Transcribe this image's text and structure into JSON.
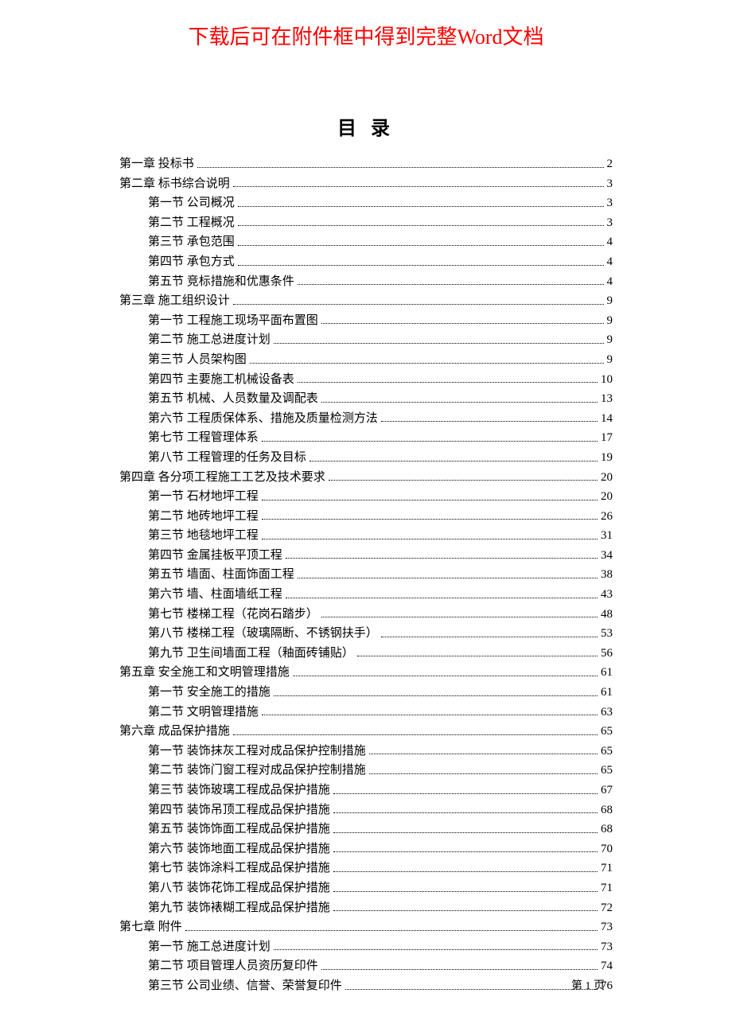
{
  "banner": "下载后可在附件框中得到完整Word文档",
  "title": "目  录",
  "toc": [
    {
      "level": 1,
      "label": "第一章  投标书",
      "page": "2"
    },
    {
      "level": 1,
      "label": "第二章  标书综合说明",
      "page": "3"
    },
    {
      "level": 2,
      "label": "第一节  公司概况",
      "page": "3"
    },
    {
      "level": 2,
      "label": "第二节  工程概况",
      "page": "3"
    },
    {
      "level": 2,
      "label": "第三节  承包范围",
      "page": "4"
    },
    {
      "level": 2,
      "label": "第四节  承包方式",
      "page": "4"
    },
    {
      "level": 2,
      "label": "第五节  竞标措施和优惠条件",
      "page": "4"
    },
    {
      "level": 1,
      "label": "第三章  施工组织设计",
      "page": "9"
    },
    {
      "level": 2,
      "label": "第一节  工程施工现场平面布置图",
      "page": "9"
    },
    {
      "level": 2,
      "label": "第二节  施工总进度计划",
      "page": "9"
    },
    {
      "level": 2,
      "label": "第三节  人员架构图",
      "page": "9"
    },
    {
      "level": 2,
      "label": "第四节  主要施工机械设备表",
      "page": "10"
    },
    {
      "level": 2,
      "label": "第五节  机械、人员数量及调配表",
      "page": "13"
    },
    {
      "level": 2,
      "label": "第六节  工程质保体系、措施及质量检测方法",
      "page": "14"
    },
    {
      "level": 2,
      "label": "第七节  工程管理体系",
      "page": "17"
    },
    {
      "level": 2,
      "label": "第八节  工程管理的任务及目标",
      "page": "19"
    },
    {
      "level": 1,
      "label": "第四章  各分项工程施工工艺及技术要求",
      "page": "20"
    },
    {
      "level": 2,
      "label": "第一节  石材地坪工程",
      "page": "20"
    },
    {
      "level": 2,
      "label": "第二节  地砖地坪工程",
      "page": "26"
    },
    {
      "level": 2,
      "label": "第三节  地毯地坪工程",
      "page": "31"
    },
    {
      "level": 2,
      "label": "第四节  金属挂板平顶工程",
      "page": "34"
    },
    {
      "level": 2,
      "label": "第五节  墙面、柱面饰面工程",
      "page": "38"
    },
    {
      "level": 2,
      "label": "第六节  墙、柱面墙纸工程",
      "page": "43"
    },
    {
      "level": 2,
      "label": "第七节  楼梯工程（花岗石踏步）",
      "page": "48"
    },
    {
      "level": 2,
      "label": "第八节  楼梯工程（玻璃隔断、不锈钢扶手）",
      "page": "53"
    },
    {
      "level": 2,
      "label": "第九节  卫生间墙面工程（釉面砖铺贴）",
      "page": "56"
    },
    {
      "level": 1,
      "label": "第五章  安全施工和文明管理措施",
      "page": "61"
    },
    {
      "level": 2,
      "label": "第一节  安全施工的措施",
      "page": "61"
    },
    {
      "level": 2,
      "label": "第二节  文明管理措施",
      "page": "63"
    },
    {
      "level": 1,
      "label": "第六章  成品保护措施",
      "page": "65"
    },
    {
      "level": 2,
      "label": "第一节  装饰抹灰工程对成品保护控制措施",
      "page": "65"
    },
    {
      "level": 2,
      "label": "第二节  装饰门窗工程对成品保护控制措施",
      "page": "65"
    },
    {
      "level": 2,
      "label": "第三节  装饰玻璃工程成品保护措施",
      "page": "67"
    },
    {
      "level": 2,
      "label": "第四节  装饰吊顶工程成品保护措施",
      "page": "68"
    },
    {
      "level": 2,
      "label": "第五节  装饰饰面工程成品保护措施",
      "page": "68"
    },
    {
      "level": 2,
      "label": "第六节  装饰地面工程成品保护措施",
      "page": "70"
    },
    {
      "level": 2,
      "label": "第七节  装饰涂料工程成品保护措施",
      "page": "71"
    },
    {
      "level": 2,
      "label": "第八节  装饰花饰工程成品保护措施",
      "page": "71"
    },
    {
      "level": 2,
      "label": "第九节  装饰裱糊工程成品保护措施",
      "page": "72"
    },
    {
      "level": 1,
      "label": "第七章  附件",
      "page": "73"
    },
    {
      "level": 2,
      "label": "第一节  施工总进度计划",
      "page": "73"
    },
    {
      "level": 2,
      "label": "第二节  项目管理人员资历复印件",
      "page": "74"
    },
    {
      "level": 2,
      "label": "第三节  公司业绩、信誉、荣誉复印件",
      "page": "76"
    }
  ],
  "footer": "第 1 页"
}
